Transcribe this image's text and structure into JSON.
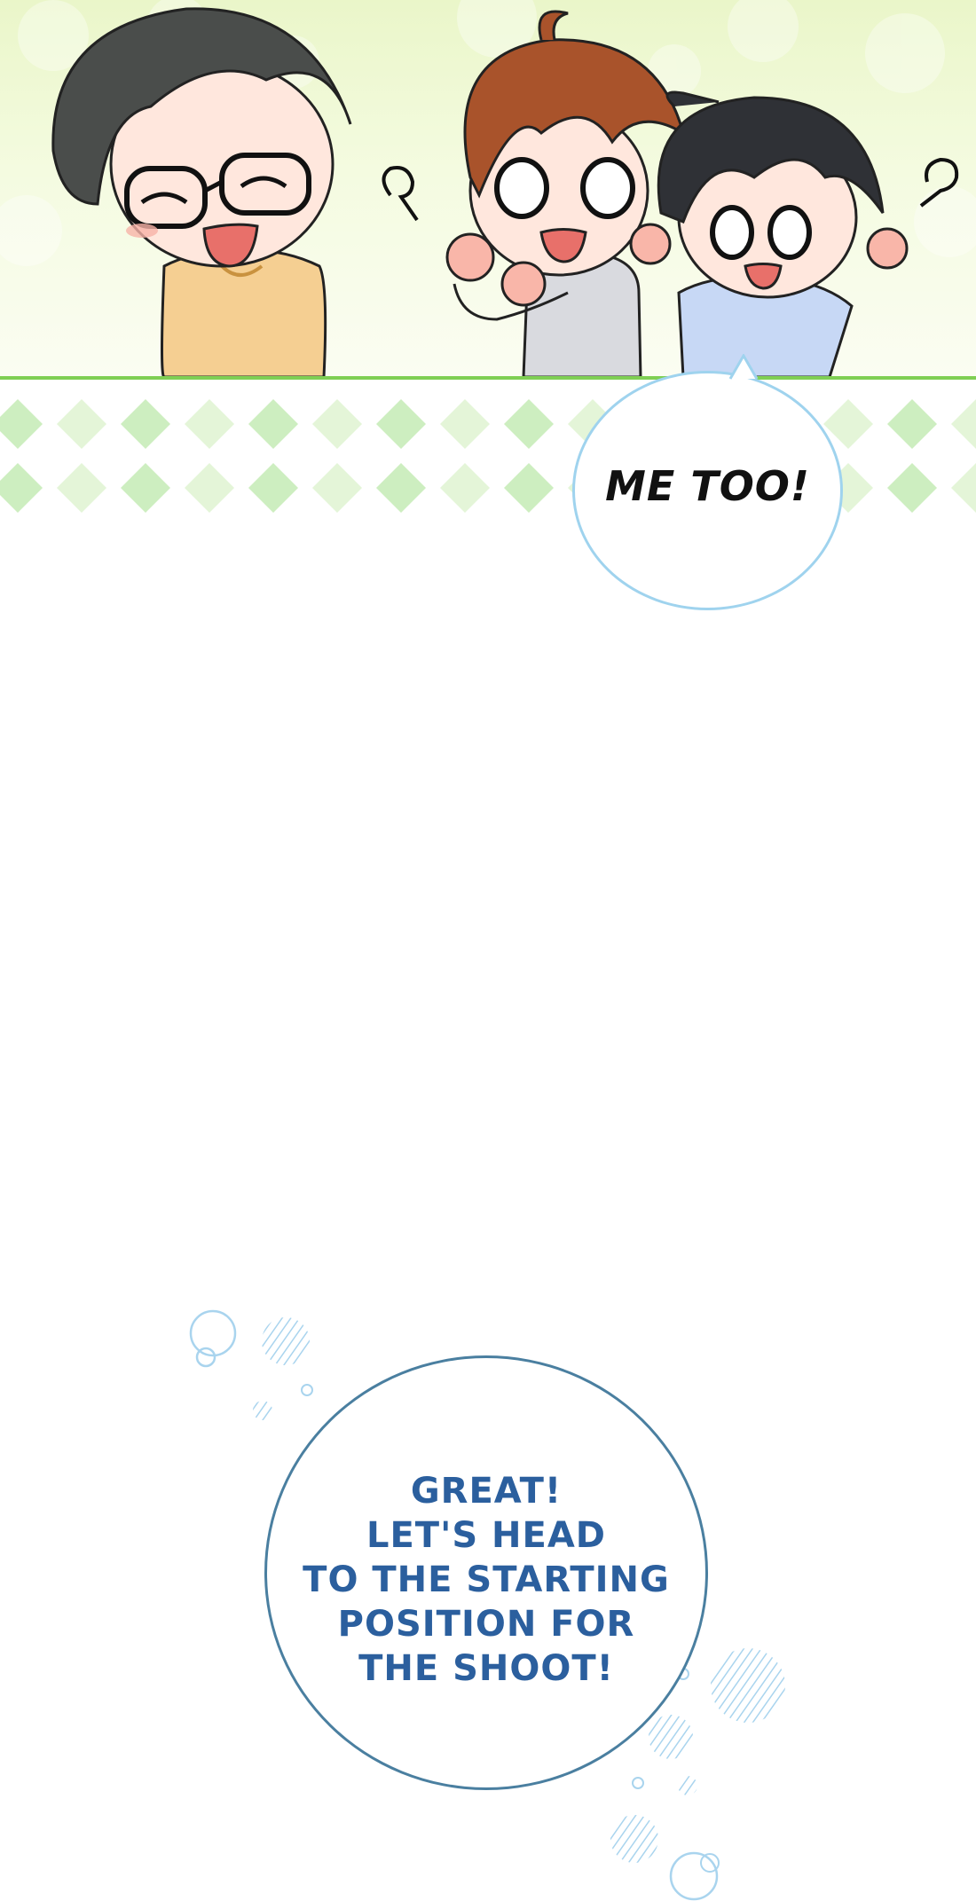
{
  "speech_bubbles": {
    "reply": {
      "text": "ME TOO!"
    },
    "announcement": {
      "lines": [
        "GREAT!",
        "LET'S HEAD",
        "TO THE STARTING",
        "POSITION FOR",
        "THE SHOOT!"
      ]
    }
  },
  "colors": {
    "panel_border": "#7fcf54",
    "diamond_light": "#e4f5d8",
    "diamond_dark": "#cdeec0",
    "announcement_text": "#2b5f9e",
    "announcement_border": "#4a7fa0",
    "reply_border": "#9fd3ee",
    "bubble_dots": "#a9d4ee"
  },
  "characters": [
    "boy-with-glasses",
    "brown-haired-boy",
    "black-haired-boy"
  ],
  "symbols": [
    "question-squiggle",
    "question-squiggle"
  ]
}
